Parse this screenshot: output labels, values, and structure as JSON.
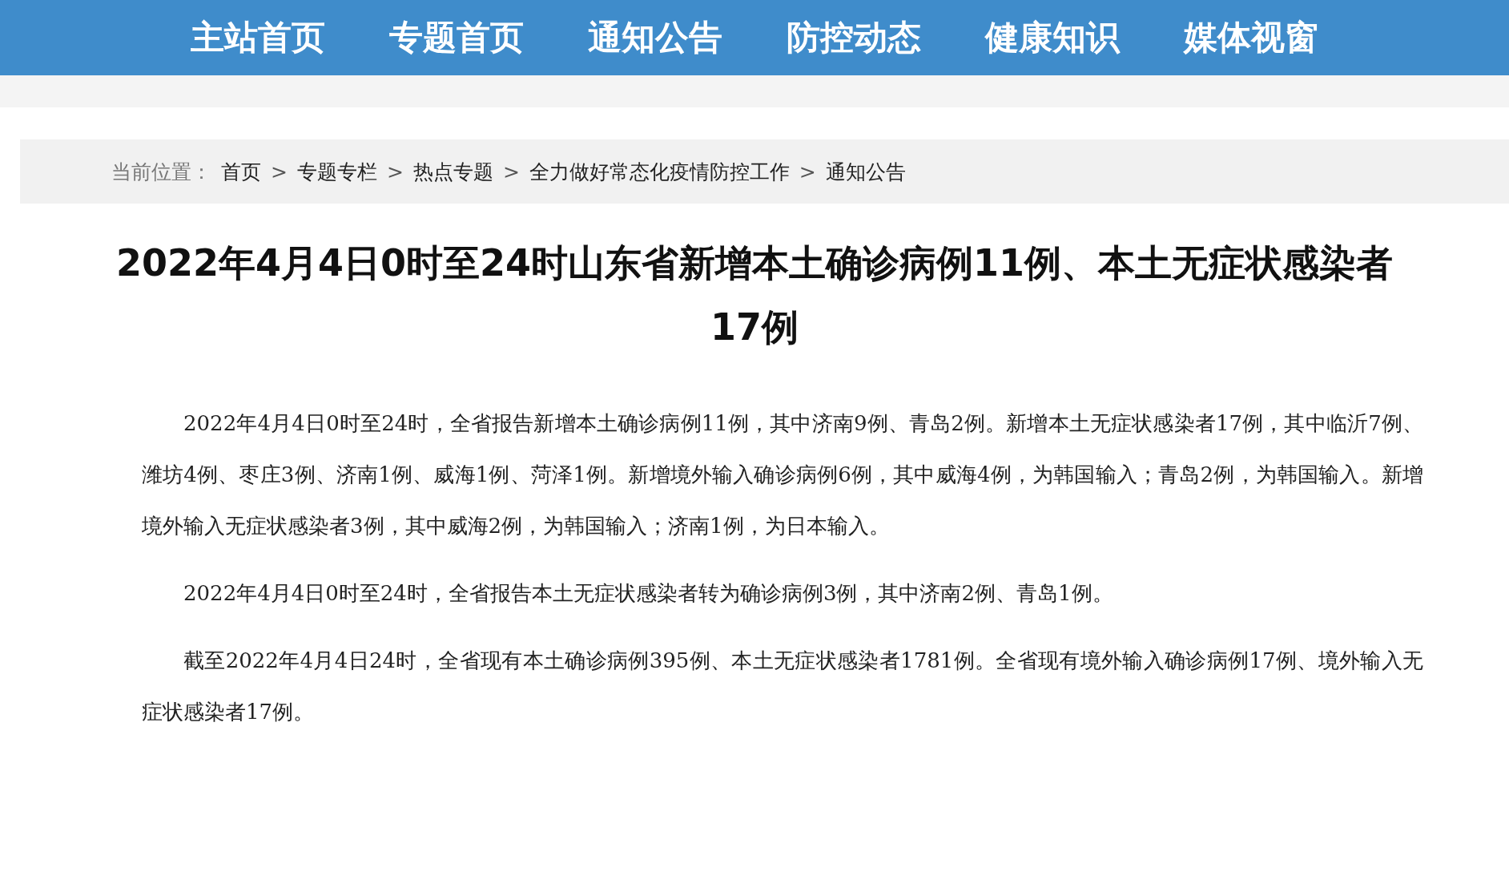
{
  "nav": {
    "items": [
      "主站首页",
      "专题首页",
      "通知公告",
      "防控动态",
      "健康知识",
      "媒体视窗"
    ]
  },
  "breadcrumb": {
    "label": "当前位置：",
    "items": [
      "首页",
      "专题专栏",
      "热点专题",
      "全力做好常态化疫情防控工作",
      "通知公告"
    ],
    "separator": ">"
  },
  "article": {
    "title": "2022年4月4日0时至24时山东省新增本土确诊病例11例、本土无症状感染者17例",
    "paragraphs": [
      "2022年4月4日0时至24时，全省报告新增本土确诊病例11例，其中济南9例、青岛2例。新增本土无症状感染者17例，其中临沂7例、潍坊4例、枣庄3例、济南1例、威海1例、菏泽1例。新增境外输入确诊病例6例，其中威海4例，为韩国输入；青岛2例，为韩国输入。新增境外输入无症状感染者3例，其中威海2例，为韩国输入；济南1例，为日本输入。",
      "2022年4月4日0时至24时，全省报告本土无症状感染者转为确诊病例3例，其中济南2例、青岛1例。",
      "截至2022年4月4日24时，全省现有本土确诊病例395例、本土无症状感染者1781例。全省现有境外输入确诊病例17例、境外输入无症状感染者17例。"
    ]
  }
}
